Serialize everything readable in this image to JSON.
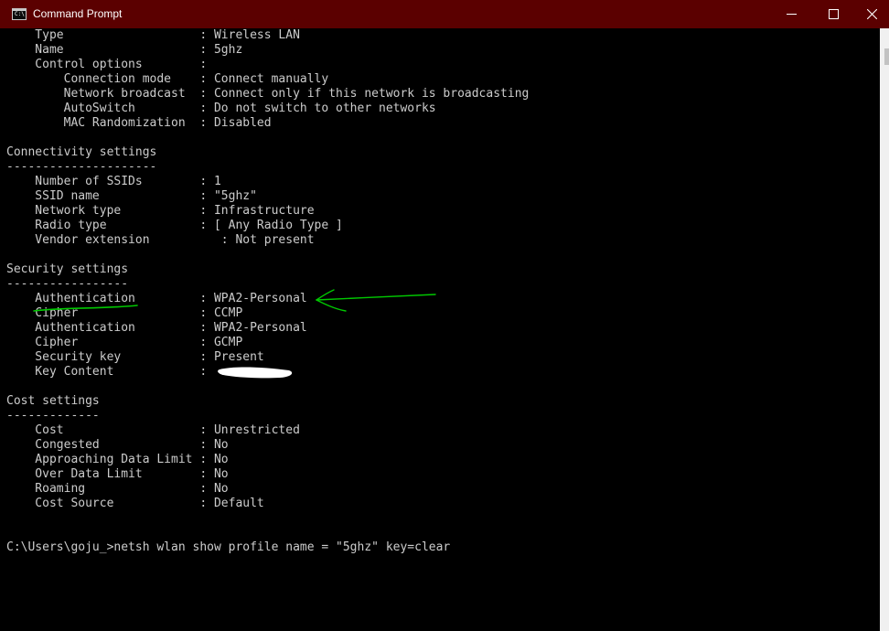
{
  "window": {
    "title": "Command Prompt",
    "icon": "cmd-icon",
    "icon_glyph": "C:\\",
    "titlebar_color": "#5b0000"
  },
  "controls": {
    "minimize": "minimize-icon",
    "maximize": "maximize-icon",
    "close": "close-icon"
  },
  "console": {
    "text_color": "#cccccc",
    "background": "#000000",
    "lines": [
      "    Type                   : Wireless LAN",
      "    Name                   : 5ghz",
      "    Control options        :",
      "        Connection mode    : Connect manually",
      "        Network broadcast  : Connect only if this network is broadcasting",
      "        AutoSwitch         : Do not switch to other networks",
      "        MAC Randomization  : Disabled",
      "",
      "Connectivity settings",
      "---------------------",
      "    Number of SSIDs        : 1",
      "    SSID name              : \"5ghz\"",
      "    Network type           : Infrastructure",
      "    Radio type             : [ Any Radio Type ]",
      "    Vendor extension          : Not present",
      "",
      "Security settings",
      "-----------------",
      "    Authentication         : WPA2-Personal",
      "    Cipher                 : CCMP",
      "    Authentication         : WPA2-Personal",
      "    Cipher                 : GCMP",
      "    Security key           : Present",
      "    Key Content            :",
      "",
      "Cost settings",
      "-------------",
      "    Cost                   : Unrestricted",
      "    Congested              : No",
      "    Approaching Data Limit : No",
      "    Over Data Limit        : No",
      "    Roaming                : No",
      "    Cost Source            : Default",
      "",
      "",
      "C:\\Users\\goju_>netsh wlan show profile name = \"5ghz\" key=clear"
    ]
  },
  "annotations": {
    "color": "#00c800",
    "underline": "underline-authentication",
    "arrow": "arrow-to-wpa2-personal"
  }
}
